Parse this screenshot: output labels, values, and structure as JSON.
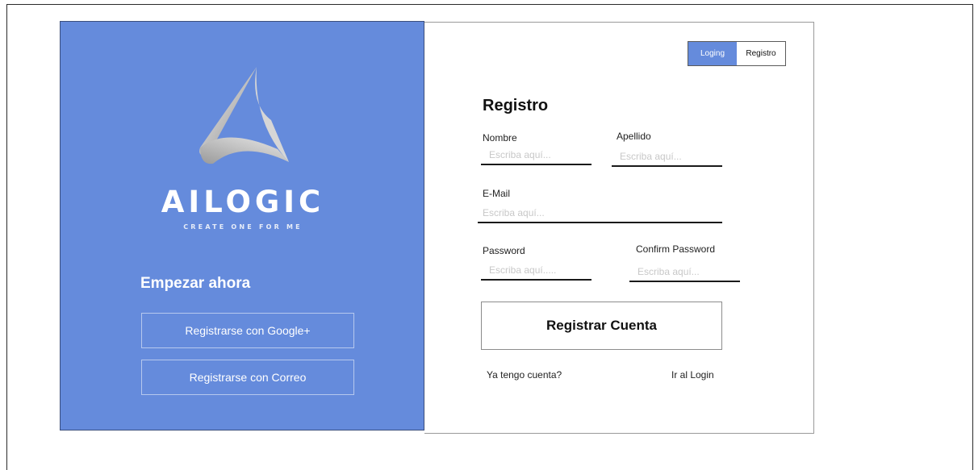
{
  "brand": {
    "name": "AILOGIC",
    "tagline": "CREATE ONE FOR ME"
  },
  "left": {
    "title": "Empezar ahora",
    "google_button": "Registrarse con Google+",
    "email_button": "Registrarse con Correo"
  },
  "tabs": [
    {
      "label": "Loging",
      "active": true
    },
    {
      "label": "Registro",
      "active": false
    }
  ],
  "form": {
    "title": "Registro",
    "fields": {
      "nombre": {
        "label": "Nombre",
        "placeholder": "Escriba aquí..."
      },
      "apellido": {
        "label": "Apellido",
        "placeholder": "Escriba aquí..."
      },
      "email": {
        "label": "E-Mail",
        "placeholder": "Escriba aquí..."
      },
      "password": {
        "label": "Password",
        "placeholder": "Escriba aquí....."
      },
      "confirm_password": {
        "label": "Confirm Password",
        "placeholder": "Escriba aquí..."
      }
    },
    "submit_label": "Registrar Cuenta",
    "have_account_text": "Ya tengo cuenta?",
    "login_link": "Ir al Login"
  },
  "colors": {
    "accent": "#658bdc",
    "text": "#111111",
    "placeholder": "#c8c8c8"
  }
}
